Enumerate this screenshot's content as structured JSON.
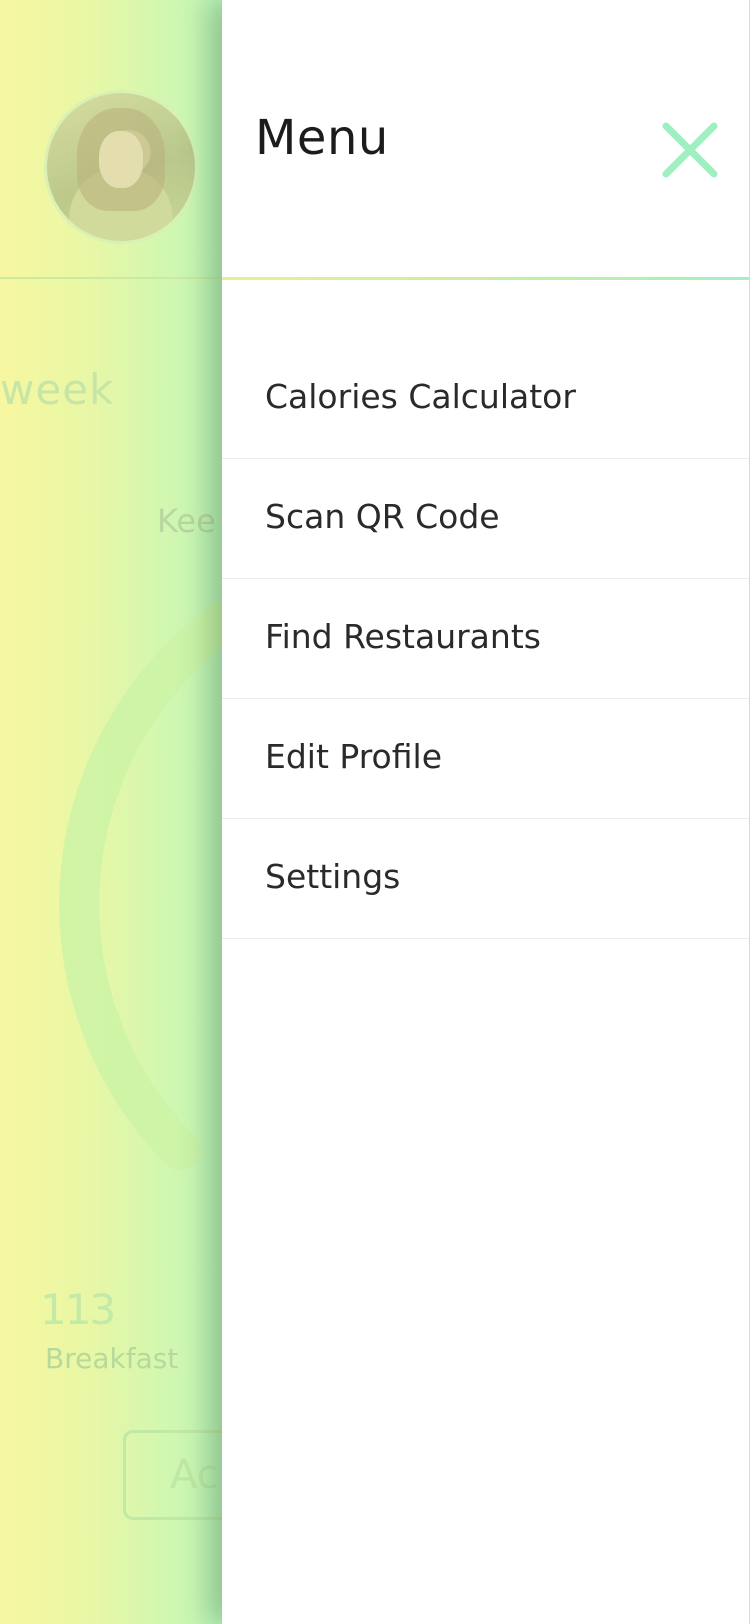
{
  "background": {
    "week_label": "week",
    "keep_label": "Kee",
    "meal_value": "113",
    "meal_label": "Breakfast",
    "add_button_label": "Ac"
  },
  "drawer": {
    "title": "Menu",
    "close_icon": "close-icon",
    "accent_color": "#9ff0c0",
    "items": [
      {
        "label": "Calories Calculator"
      },
      {
        "label": "Scan QR Code"
      },
      {
        "label": "Find Restaurants"
      },
      {
        "label": "Edit Profile"
      },
      {
        "label": "Settings"
      }
    ]
  }
}
